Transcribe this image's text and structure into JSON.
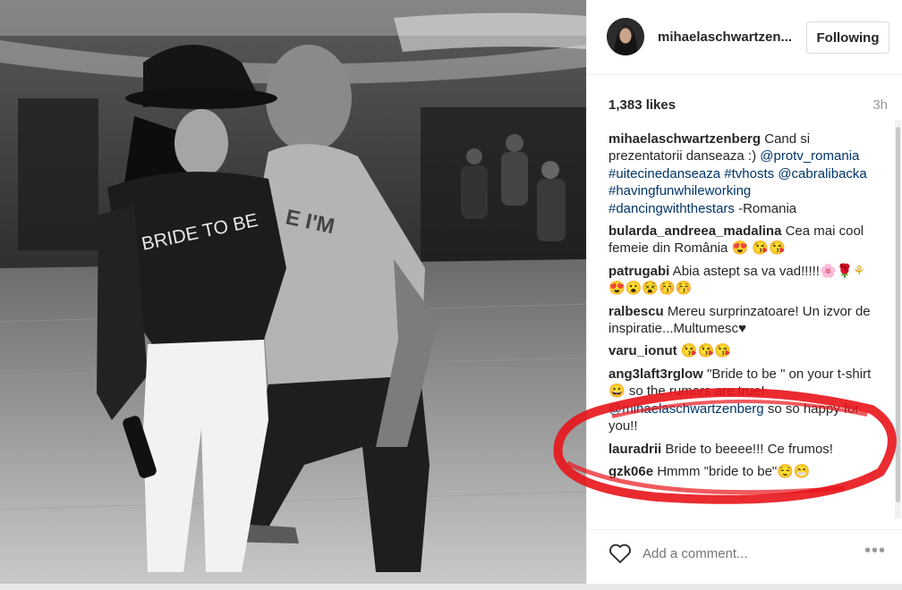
{
  "post": {
    "username": "mihaelaschwartzen...",
    "follow_label": "Following",
    "likes": "1,383 likes",
    "time": "3h"
  },
  "photo": {
    "shirt_text": "BRIDE TO BE",
    "tee_text": "E I'M"
  },
  "comments": [
    {
      "user": "mihaelaschwartzenberg",
      "parts": [
        {
          "t": " Cand si prezentatorii danseaza :) "
        },
        {
          "t": "@protv_romania",
          "c": "tag"
        },
        {
          "t": " "
        },
        {
          "t": "#uitecinedanseaza",
          "c": "tag"
        },
        {
          "t": " "
        },
        {
          "t": "#tvhosts",
          "c": "tag"
        },
        {
          "t": " "
        },
        {
          "t": "@cabralibacka",
          "c": "tag"
        },
        {
          "t": " "
        },
        {
          "t": "#havingfunwhileworking",
          "c": "tag"
        },
        {
          "t": " "
        },
        {
          "t": "#dancingwiththestars",
          "c": "tag"
        },
        {
          "t": " -Romania"
        }
      ]
    },
    {
      "user": "bularda_andreea_madalina",
      "parts": [
        {
          "t": " Cea mai cool femeie din România "
        },
        {
          "t": "😍 😘😘",
          "c": "emo"
        }
      ]
    },
    {
      "user": "patrugabi",
      "parts": [
        {
          "t": " Abia astept sa va vad!!!!!"
        },
        {
          "t": "🌸🌹⚘ 😍😮😵😚😚",
          "c": "emo"
        }
      ]
    },
    {
      "user": "ralbescu",
      "parts": [
        {
          "t": " Mereu surprinzatoare! Un izvor de inspiratie...Multumesc"
        },
        {
          "t": "♥",
          "c": "plain"
        }
      ]
    },
    {
      "user": "varu_ionut",
      "parts": [
        {
          "t": " 😘😘😘",
          "c": "emo"
        }
      ]
    },
    {
      "user": "ang3laft3rglow",
      "parts": [
        {
          "t": " \"Bride to be \" on your t-shirt "
        },
        {
          "t": "😀",
          "c": "emo"
        },
        {
          "t": " so the rumors are true! "
        },
        {
          "t": "@mihaelaschwartzenberg",
          "c": "tag"
        },
        {
          "t": " so so happy for you!!"
        }
      ]
    },
    {
      "user": "lauradrii",
      "parts": [
        {
          "t": " Bride to beeee!!! Ce frumos!"
        }
      ]
    },
    {
      "user": "gzk06e",
      "parts": [
        {
          "t": " Hmmm \"bride to be\""
        },
        {
          "t": "😌😁",
          "c": "emo"
        }
      ]
    }
  ],
  "footer": {
    "comment_placeholder": "Add a comment...",
    "more_label": "•••"
  },
  "colors": {
    "link": "#003569",
    "annotation_red": "#e8141a"
  }
}
